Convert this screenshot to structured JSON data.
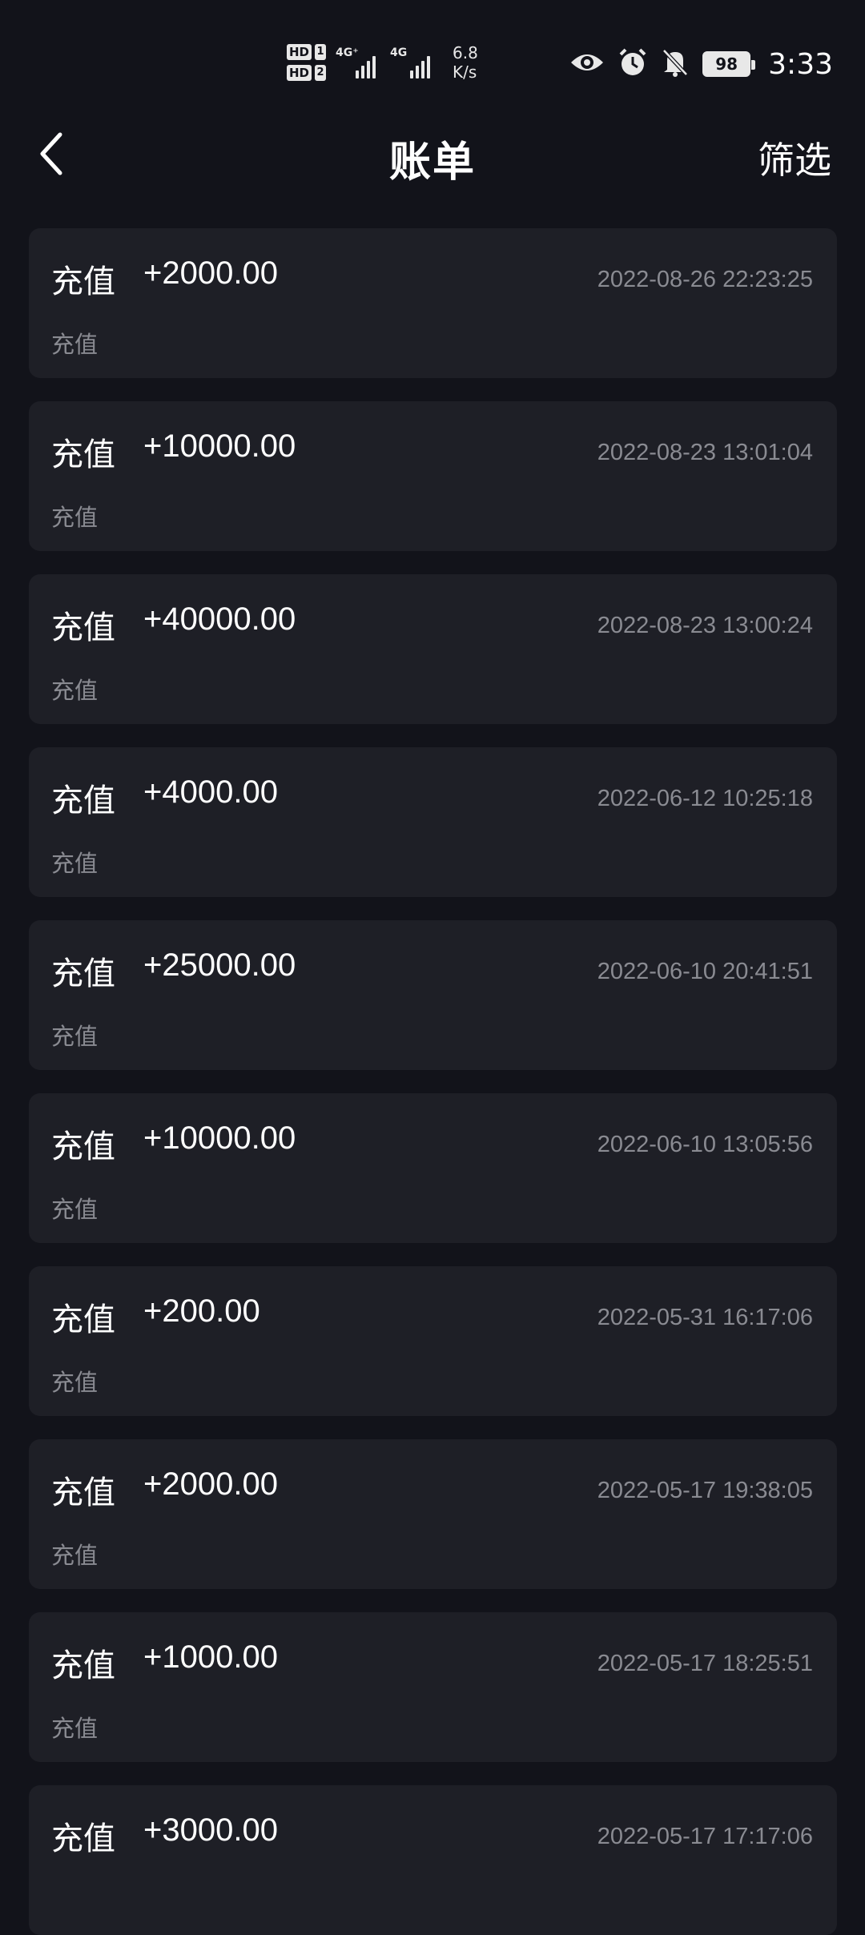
{
  "status_bar": {
    "hd1": "HD",
    "hd1_num": "1",
    "hd2": "HD",
    "hd2_num": "2",
    "net1": "4G⁺",
    "net2": "4G",
    "speed_value": "6.8",
    "speed_unit": "K/s",
    "battery": "98",
    "time": "3:33",
    "icons": [
      "eye-icon",
      "alarm-icon",
      "bell-muted-icon",
      "battery-icon"
    ]
  },
  "header": {
    "title": "账单",
    "back_icon": "chevron-left-icon",
    "filter_label": "筛选"
  },
  "bills": [
    {
      "type": "充值",
      "amount": "+2000.00",
      "time": "2022-08-26 22:23:25",
      "desc": "充值"
    },
    {
      "type": "充值",
      "amount": "+10000.00",
      "time": "2022-08-23 13:01:04",
      "desc": "充值"
    },
    {
      "type": "充值",
      "amount": "+40000.00",
      "time": "2022-08-23 13:00:24",
      "desc": "充值"
    },
    {
      "type": "充值",
      "amount": "+4000.00",
      "time": "2022-06-12 10:25:18",
      "desc": "充值"
    },
    {
      "type": "充值",
      "amount": "+25000.00",
      "time": "2022-06-10 20:41:51",
      "desc": "充值"
    },
    {
      "type": "充值",
      "amount": "+10000.00",
      "time": "2022-06-10 13:05:56",
      "desc": "充值"
    },
    {
      "type": "充值",
      "amount": "+200.00",
      "time": "2022-05-31 16:17:06",
      "desc": "充值"
    },
    {
      "type": "充值",
      "amount": "+2000.00",
      "time": "2022-05-17 19:38:05",
      "desc": "充值"
    },
    {
      "type": "充值",
      "amount": "+1000.00",
      "time": "2022-05-17 18:25:51",
      "desc": "充值"
    },
    {
      "type": "充值",
      "amount": "+3000.00",
      "time": "2022-05-17 17:17:06",
      "desc": ""
    }
  ]
}
